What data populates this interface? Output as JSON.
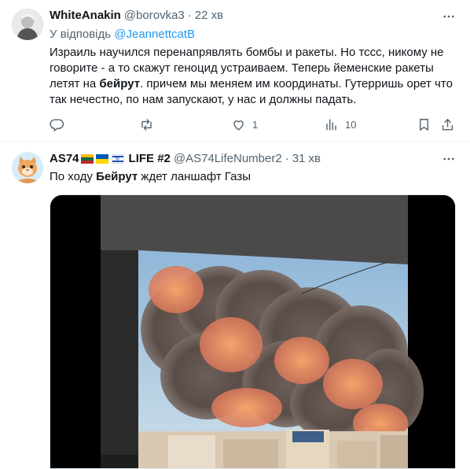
{
  "tweets": [
    {
      "name": "WhiteAnakin",
      "handle": "@borovka3",
      "time": "22 хв",
      "replying_prefix": "У відповідь",
      "replying_mention": "@JeannettcatB",
      "lines": [
        [
          "Израиль научился перенапрявлять бомбы и ракеты. Но тссс, никому не"
        ],
        [
          "говорите  - а то скажут геноцид устраиваем. Теперь йеменские ракеты"
        ],
        [
          "летят на ",
          "бейрут",
          ". причем мы меняем им координаты. Гутерришь орет что"
        ],
        [
          "так нечестно, по нам запускают, у нас и должны падать."
        ]
      ],
      "actions": {
        "reply_count": "",
        "retweet_count": "",
        "like_count": "1",
        "views_count": "10"
      }
    },
    {
      "name": "AS74",
      "life_label": "LIFE #2",
      "handle": "@AS74LifeNumber2",
      "time": "31 хв",
      "text_before": "По ходу ",
      "text_bold": "Бейрут",
      "text_after": " ждет ланшафт Газы"
    }
  ],
  "icons": [
    "more-icon",
    "reply-icon",
    "retweet-icon",
    "like-icon",
    "views-icon",
    "bookmark-icon",
    "share-icon",
    "flag-lithuania",
    "flag-ukraine",
    "flag-israel"
  ],
  "colors": {
    "text": "#0f1419",
    "secondary": "#536471",
    "link": "#1d9bf0",
    "divider": "#eff3f4"
  }
}
